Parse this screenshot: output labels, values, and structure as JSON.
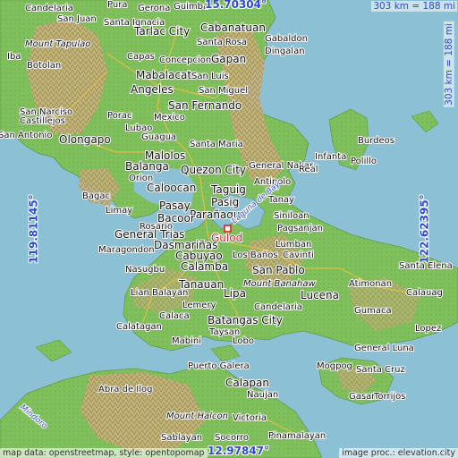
{
  "map": {
    "selected_place": "Gulod",
    "coordinates": {
      "north": "15.70304°",
      "south": "12.97847°",
      "west": "119.81145°",
      "east": "122.62395°"
    },
    "scale": {
      "top": "303 km = 188 mi",
      "right": "303 km = 188 mi"
    },
    "credits": {
      "left": "map data: openstreetmap, style: opentopomap",
      "right": "image proc.: elevation.city"
    },
    "colors": {
      "sea": "#8cc0d4",
      "lowland": "#7fbf5a",
      "upland": "#c8b07a",
      "highland": "#e6dcc6",
      "label_blue": "#2a4ad0",
      "selected": "#e02020"
    },
    "places": [
      {
        "name": "Candelaria"
      },
      {
        "name": "Pura"
      },
      {
        "name": "Gerona"
      },
      {
        "name": "Guimba"
      },
      {
        "name": "San Juan"
      },
      {
        "name": "Santa Ignacia"
      },
      {
        "name": "Tarlac City"
      },
      {
        "name": "Cabanatuan"
      },
      {
        "name": "Santa Rosa"
      },
      {
        "name": "Gabaldon"
      },
      {
        "name": "Mount Tapulao"
      },
      {
        "name": "Dingalan"
      },
      {
        "name": "Iba"
      },
      {
        "name": "Capas"
      },
      {
        "name": "Botolan"
      },
      {
        "name": "Concepcion"
      },
      {
        "name": "Gapan"
      },
      {
        "name": "Mabalacat"
      },
      {
        "name": "San Luis"
      },
      {
        "name": "Angeles"
      },
      {
        "name": "San Miguel"
      },
      {
        "name": "San Narciso"
      },
      {
        "name": "San Fernando"
      },
      {
        "name": "Porac"
      },
      {
        "name": "Mexico"
      },
      {
        "name": "Castillejos"
      },
      {
        "name": "Lubao"
      },
      {
        "name": "San Antonio"
      },
      {
        "name": "Olongapo"
      },
      {
        "name": "Guagua"
      },
      {
        "name": "Santa Maria"
      },
      {
        "name": "Malolos"
      },
      {
        "name": "Burdeos"
      },
      {
        "name": "Quezon City"
      },
      {
        "name": "Infanta"
      },
      {
        "name": "Polillo"
      },
      {
        "name": "Balanga"
      },
      {
        "name": "Orion"
      },
      {
        "name": "General Nakar"
      },
      {
        "name": "Real"
      },
      {
        "name": "Caloocan"
      },
      {
        "name": "Antipolo"
      },
      {
        "name": "Bagac"
      },
      {
        "name": "Taguig"
      },
      {
        "name": "Pasig"
      },
      {
        "name": "Limay"
      },
      {
        "name": "Tanay"
      },
      {
        "name": "Pasay"
      },
      {
        "name": "Parañaque"
      },
      {
        "name": "Bacoor"
      },
      {
        "name": "Siniloan"
      },
      {
        "name": "Rosario"
      },
      {
        "name": "General Trias"
      },
      {
        "name": "Pagsanjan"
      },
      {
        "name": "Laguna de Bay"
      },
      {
        "name": "Gulod"
      },
      {
        "name": "Dasmariñas"
      },
      {
        "name": "Lumban"
      },
      {
        "name": "Maragondon"
      },
      {
        "name": "Cabuyao"
      },
      {
        "name": "Cavinti"
      },
      {
        "name": "Calamba"
      },
      {
        "name": "Los Baños"
      },
      {
        "name": "San Pablo"
      },
      {
        "name": "Nasugbu"
      },
      {
        "name": "Santa Elena"
      },
      {
        "name": "Tanauan"
      },
      {
        "name": "Mount Banahaw"
      },
      {
        "name": "Lian"
      },
      {
        "name": "Balayan"
      },
      {
        "name": "Lipa"
      },
      {
        "name": "Lucena"
      },
      {
        "name": "Atimonan"
      },
      {
        "name": "Calauag"
      },
      {
        "name": "Lemery"
      },
      {
        "name": "Candelaria"
      },
      {
        "name": "Gumaca"
      },
      {
        "name": "Calaca"
      },
      {
        "name": "Batangas City"
      },
      {
        "name": "Calatagan"
      },
      {
        "name": "Taysan"
      },
      {
        "name": "Lopez"
      },
      {
        "name": "Mabini"
      },
      {
        "name": "Lobo"
      },
      {
        "name": "General Luna"
      },
      {
        "name": "Mogpog"
      },
      {
        "name": "Puerto Galera"
      },
      {
        "name": "Santa Cruz"
      },
      {
        "name": "Abra de Ilog"
      },
      {
        "name": "Calapan"
      },
      {
        "name": "Gasan"
      },
      {
        "name": "Torrijos"
      },
      {
        "name": "Naujan"
      },
      {
        "name": "Mount Halcon"
      },
      {
        "name": "Victoria"
      },
      {
        "name": "Socorro"
      },
      {
        "name": "Pinamalayan"
      },
      {
        "name": "Sablayan"
      },
      {
        "name": "Mindoro"
      }
    ]
  }
}
